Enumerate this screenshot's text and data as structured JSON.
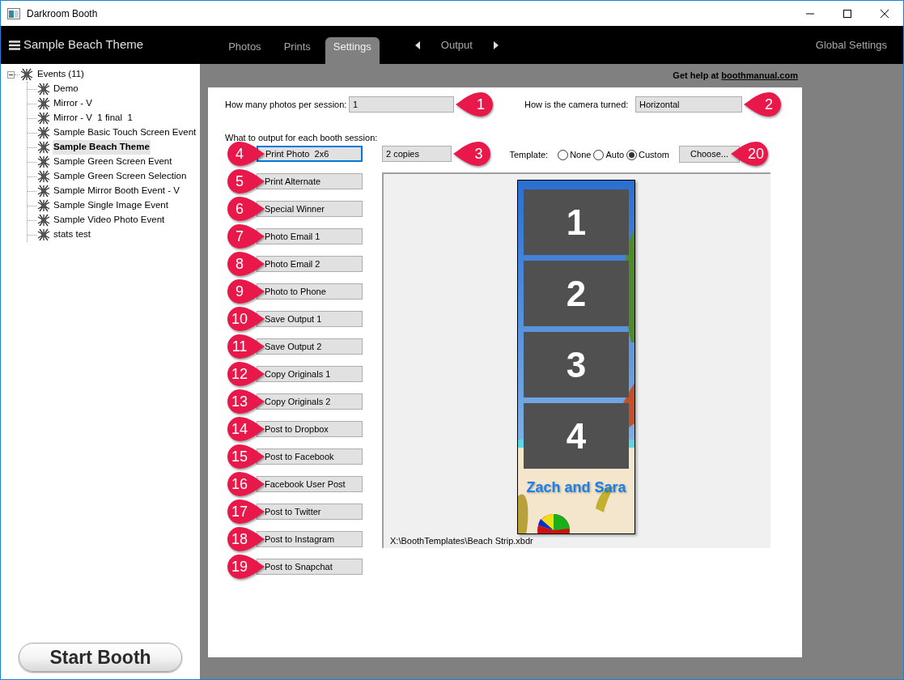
{
  "window": {
    "title": "Darkroom Booth"
  },
  "header": {
    "event_name": "Sample Beach Theme",
    "tabs": [
      {
        "label": "Photos",
        "selected": false
      },
      {
        "label": "Prints",
        "selected": false
      },
      {
        "label": "Settings",
        "selected": true
      }
    ],
    "output_label": "Output",
    "global_settings": "Global Settings"
  },
  "sidebar": {
    "tree": {
      "label": "Events (11)",
      "expanded": true,
      "children": [
        {
          "label": "Demo",
          "selected": false
        },
        {
          "label": "Mirror - V",
          "selected": false
        },
        {
          "label": "Mirror - V  1 final  1",
          "selected": false
        },
        {
          "label": "Sample Basic Touch Screen Event",
          "selected": false
        },
        {
          "label": "Sample Beach Theme",
          "selected": true
        },
        {
          "label": "Sample Green Screen Event",
          "selected": false
        },
        {
          "label": "Sample Green Screen Selection",
          "selected": false
        },
        {
          "label": "Sample Mirror Booth Event - V",
          "selected": false
        },
        {
          "label": "Sample Single Image Event",
          "selected": false
        },
        {
          "label": "Sample Video Photo Event",
          "selected": false
        },
        {
          "label": "stats test",
          "selected": false
        }
      ]
    },
    "start_button": "Start Booth"
  },
  "settings": {
    "help": {
      "text": "Get help at",
      "link": "boothmanual.com"
    },
    "photos_per_session": {
      "label": "How many photos per session:",
      "value": "1",
      "callout": "1"
    },
    "camera": {
      "label": "How is the camera turned:",
      "value": "Horizontal",
      "callout": "2"
    },
    "outputs_heading": "What to output for each booth session:",
    "outputs": [
      {
        "label": "Print Photo  2x6",
        "callout": "4",
        "selected": true
      },
      {
        "label": "Print Alternate",
        "callout": "5",
        "selected": false
      },
      {
        "label": "Special Winner",
        "callout": "6",
        "selected": false
      },
      {
        "label": "Photo Email 1",
        "callout": "7",
        "selected": false
      },
      {
        "label": "Photo Email 2",
        "callout": "8",
        "selected": false
      },
      {
        "label": "Photo to Phone",
        "callout": "9",
        "selected": false
      },
      {
        "label": "Save Output 1",
        "callout": "10",
        "selected": false
      },
      {
        "label": "Save Output 2",
        "callout": "11",
        "selected": false
      },
      {
        "label": "Copy Originals 1",
        "callout": "12",
        "selected": false
      },
      {
        "label": "Copy Originals 2",
        "callout": "13",
        "selected": false
      },
      {
        "label": "Post to Dropbox",
        "callout": "14",
        "selected": false
      },
      {
        "label": "Post to Facebook",
        "callout": "15",
        "selected": false
      },
      {
        "label": "Facebook User Post",
        "callout": "16",
        "selected": false
      },
      {
        "label": "Post to Twitter",
        "callout": "17",
        "selected": false
      },
      {
        "label": "Post to Instagram",
        "callout": "18",
        "selected": false
      },
      {
        "label": "Post to Snapchat",
        "callout": "19",
        "selected": false
      }
    ],
    "copies": {
      "value": "2 copies",
      "callout": "3"
    },
    "template": {
      "label": "Template:",
      "options": [
        {
          "label": "None",
          "selected": false
        },
        {
          "label": "Auto",
          "selected": false
        },
        {
          "label": "Custom",
          "selected": true
        }
      ],
      "choose_button": "Choose...",
      "callout": "20"
    },
    "preview": {
      "frames": [
        "1",
        "2",
        "3",
        "4"
      ],
      "caption": "Zach and Sara",
      "path": "X:\\BoothTemplates\\Beach Strip.xbdr"
    }
  }
}
